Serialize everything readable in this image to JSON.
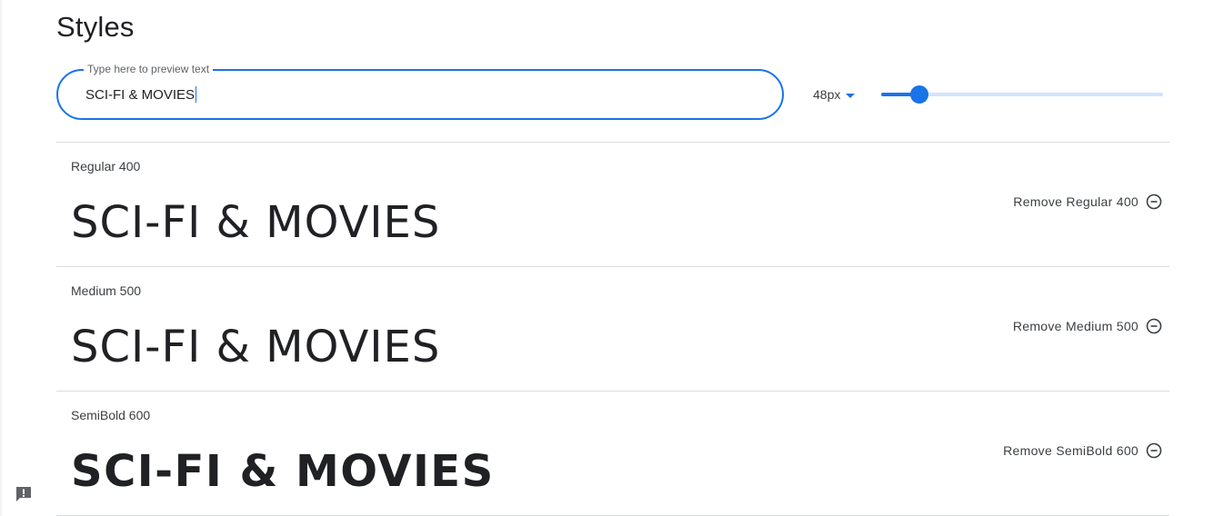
{
  "header": {
    "title": "Styles"
  },
  "preview": {
    "label": "Type here to preview text",
    "value": "SCI-FI & MOVIES"
  },
  "size": {
    "value": "48px",
    "slider_percent": 13.5
  },
  "styles": [
    {
      "name": "Regular 400",
      "sample": "SCI-FI & MOVIES",
      "remove_label": "Remove Regular 400"
    },
    {
      "name": "Medium 500",
      "sample": "SCI-FI & MOVIES",
      "remove_label": "Remove Medium 500"
    },
    {
      "name": "SemiBold 600",
      "sample": "SCI-FI & MOVIES",
      "remove_label": "Remove SemiBold 600"
    }
  ],
  "icons": {
    "remove": "remove-circle-icon",
    "size_dropdown": "dropdown-arrow-icon",
    "feedback": "feedback-icon"
  },
  "colors": {
    "accent": "#1a73e8",
    "track": "#d2e3fc",
    "divider": "#dadce0",
    "text": "#202124"
  }
}
